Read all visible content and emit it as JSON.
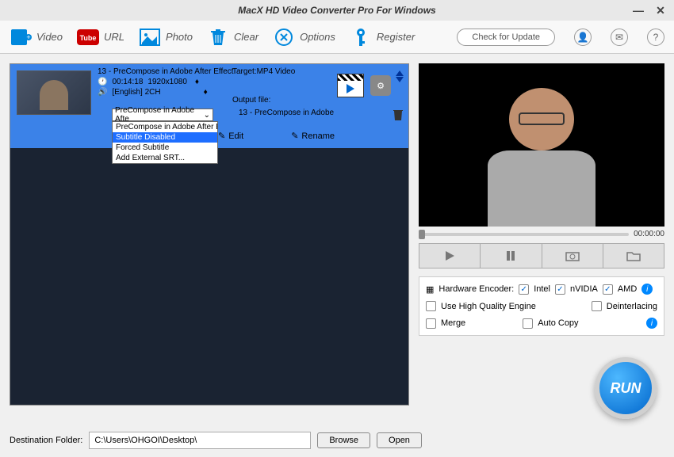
{
  "titlebar": {
    "title": "MacX HD Video Converter Pro For Windows"
  },
  "toolbar": {
    "video": "Video",
    "url": "URL",
    "photo": "Photo",
    "clear": "Clear",
    "options": "Options",
    "register": "Register",
    "check_update": "Check for Update"
  },
  "file": {
    "title": "13 - PreCompose in Adobe After Effect",
    "target": "Target:MP4 Video",
    "duration": "00:14:18",
    "resolution": "1920x1080",
    "audio": "[English] 2CH",
    "subtitle_value": "PreCompose in Adobe Afte",
    "output_label": "Output file:",
    "output_name": "13 - PreCompose in Adobe",
    "edit": "Edit",
    "rename": "Rename"
  },
  "dropdown": {
    "items": [
      "PreCompose in Adobe After Ef",
      "Subtitle Disabled",
      "Forced Subtitle",
      "Add External SRT..."
    ],
    "selected_index": 1
  },
  "preview": {
    "time": "00:00:00"
  },
  "encoder": {
    "label": "Hardware Encoder:",
    "intel": "Intel",
    "nvidia": "nVIDIA",
    "amd": "AMD",
    "hq": "Use High Quality Engine",
    "deint": "Deinterlacing",
    "merge": "Merge",
    "autocopy": "Auto Copy"
  },
  "run": "RUN",
  "footer": {
    "label": "Destination Folder:",
    "path": "C:\\Users\\OHGOI\\Desktop\\",
    "browse": "Browse",
    "open": "Open"
  }
}
